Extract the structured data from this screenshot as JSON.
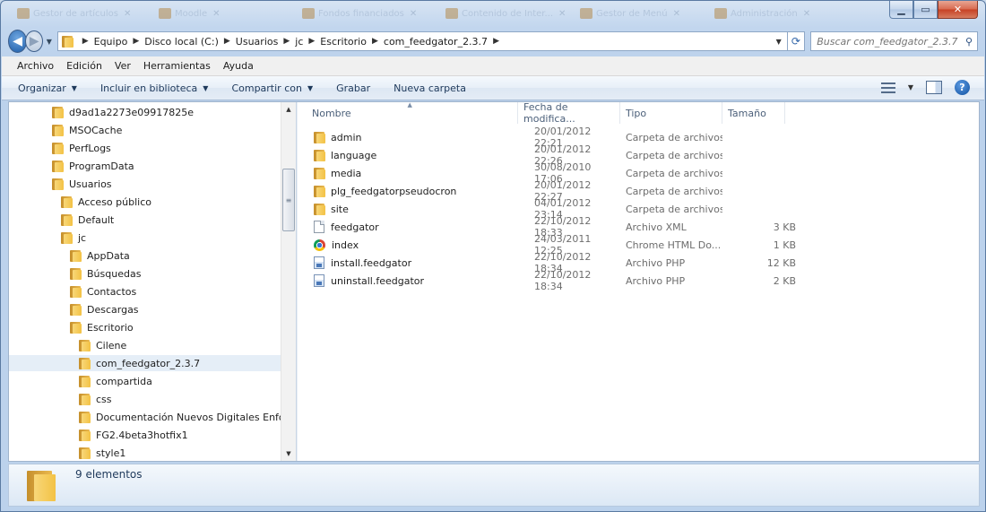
{
  "titlebar": {
    "ghost_tabs": [
      "Gestor de artículos",
      "Moodle",
      "Fondos financiados",
      "Contenido de Inter...",
      "Gestor de Menú",
      "Administración"
    ]
  },
  "address": {
    "crumbs": [
      "Equipo",
      "Disco local (C:)",
      "Usuarios",
      "jc",
      "Escritorio",
      "com_feedgator_2.3.7"
    ]
  },
  "search": {
    "placeholder": "Buscar com_feedgator_2.3.7"
  },
  "menu": [
    "Archivo",
    "Edición",
    "Ver",
    "Herramientas",
    "Ayuda"
  ],
  "commands": {
    "organize": "Organizar",
    "library": "Incluir en biblioteca",
    "share": "Compartir con",
    "burn": "Grabar",
    "new_folder": "Nueva carpeta"
  },
  "nav": {
    "items": [
      {
        "label": "d9ad1a2273e09917825e",
        "icon": "folder-icon"
      },
      {
        "label": "MSOCache",
        "icon": "locked-folder-icon"
      },
      {
        "label": "PerfLogs",
        "icon": "folder-icon"
      },
      {
        "label": "ProgramData",
        "icon": "folder-icon"
      },
      {
        "label": "Usuarios",
        "icon": "folder-icon"
      },
      {
        "label": "Acceso público",
        "icon": "folder-icon"
      },
      {
        "label": "Default",
        "icon": "folder-icon"
      },
      {
        "label": "jc",
        "icon": "user-folder-icon"
      },
      {
        "label": "AppData",
        "icon": "folder-icon"
      },
      {
        "label": "Búsquedas",
        "icon": "searches-folder-icon"
      },
      {
        "label": "Contactos",
        "icon": "contacts-folder-icon"
      },
      {
        "label": "Descargas",
        "icon": "downloads-folder-icon"
      },
      {
        "label": "Escritorio",
        "icon": "desktop-folder-icon"
      },
      {
        "label": "Cilene",
        "icon": "folder-icon"
      },
      {
        "label": "com_feedgator_2.3.7",
        "icon": "folder-icon",
        "selected": true
      },
      {
        "label": "compartida",
        "icon": "folder-icon"
      },
      {
        "label": "css",
        "icon": "folder-icon"
      },
      {
        "label": "Documentación Nuevos Digitales Enfoque",
        "icon": "folder-icon"
      },
      {
        "label": "FG2.4beta3hotfix1",
        "icon": "folder-icon"
      },
      {
        "label": "style1",
        "icon": "folder-icon"
      }
    ]
  },
  "columns": [
    "Nombre",
    "Fecha de modifica...",
    "Tipo",
    "Tamaño"
  ],
  "files": [
    {
      "name": "admin",
      "date": "20/01/2012 22:21",
      "type": "Carpeta de archivos",
      "size": "",
      "icon": "folder"
    },
    {
      "name": "language",
      "date": "20/01/2012 22:26",
      "type": "Carpeta de archivos",
      "size": "",
      "icon": "folder"
    },
    {
      "name": "media",
      "date": "30/08/2010 17:06",
      "type": "Carpeta de archivos",
      "size": "",
      "icon": "folder"
    },
    {
      "name": "plg_feedgatorpseudocron",
      "date": "20/01/2012 22:27",
      "type": "Carpeta de archivos",
      "size": "",
      "icon": "folder"
    },
    {
      "name": "site",
      "date": "04/01/2012 23:14",
      "type": "Carpeta de archivos",
      "size": "",
      "icon": "folder"
    },
    {
      "name": "feedgator",
      "date": "22/10/2012 18:33",
      "type": "Archivo XML",
      "size": "3 KB",
      "icon": "doc"
    },
    {
      "name": "index",
      "date": "24/03/2011 12:25",
      "type": "Chrome HTML Do...",
      "size": "1 KB",
      "icon": "chrome"
    },
    {
      "name": "install.feedgator",
      "date": "22/10/2012 18:34",
      "type": "Archivo PHP",
      "size": "12 KB",
      "icon": "php"
    },
    {
      "name": "uninstall.feedgator",
      "date": "22/10/2012 18:34",
      "type": "Archivo PHP",
      "size": "2 KB",
      "icon": "php"
    }
  ],
  "status": {
    "count_text": "9 elementos"
  }
}
